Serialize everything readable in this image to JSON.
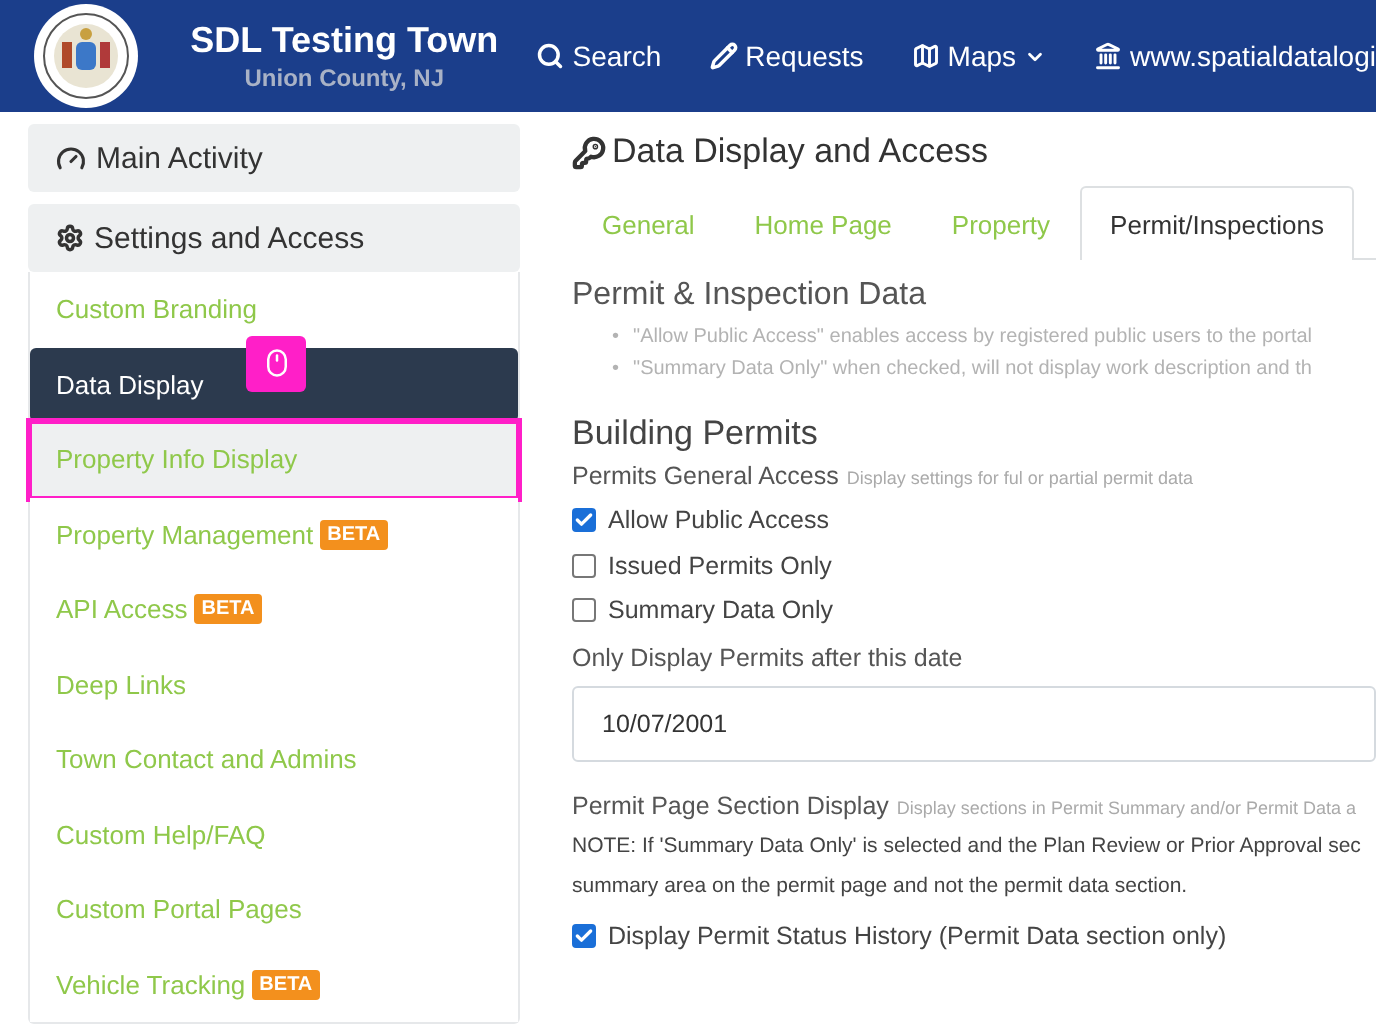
{
  "header": {
    "title": "SDL Testing Town",
    "subtitle": "Union County, NJ",
    "nav": [
      {
        "kind": "search",
        "label": "Search"
      },
      {
        "kind": "pencil",
        "label": "Requests"
      },
      {
        "kind": "map",
        "label": "Maps",
        "dropdown": true
      },
      {
        "kind": "bank",
        "label": "www.spatialdatalogi"
      }
    ]
  },
  "sidebar": {
    "main_panel": "Main Activity",
    "settings_panel": "Settings and Access",
    "items": [
      {
        "label": "Custom Branding",
        "selected": false,
        "highlighted": false
      },
      {
        "label": "Data Display",
        "selected": true,
        "highlighted": false,
        "pointer": true
      },
      {
        "label": "Property Info Display",
        "selected": false,
        "highlighted": true
      },
      {
        "label": "Property Management",
        "selected": false,
        "highlighted": false,
        "badge": "BETA"
      },
      {
        "label": "API Access",
        "selected": false,
        "highlighted": false,
        "badge": "BETA"
      },
      {
        "label": "Deep Links",
        "selected": false,
        "highlighted": false
      },
      {
        "label": "Town Contact and Admins",
        "selected": false,
        "highlighted": false
      },
      {
        "label": "Custom Help/FAQ",
        "selected": false,
        "highlighted": false
      },
      {
        "label": "Custom Portal Pages",
        "selected": false,
        "highlighted": false
      },
      {
        "label": "Vehicle Tracking",
        "selected": false,
        "highlighted": false,
        "badge": "BETA"
      }
    ]
  },
  "main": {
    "title": "Data Display and Access",
    "tabs": [
      {
        "label": "General",
        "selected": false
      },
      {
        "label": "Home Page",
        "selected": false
      },
      {
        "label": "Property",
        "selected": false
      },
      {
        "label": "Permit/Inspections",
        "selected": true
      }
    ],
    "section_title": "Permit & Inspection Data",
    "bullets": [
      {
        "marker": "•",
        "text": "\"Allow Public Access\" enables access by registered public users to the portal"
      },
      {
        "marker": "•",
        "text": "\"Summary Data Only\" when checked, will not display work description and th"
      }
    ],
    "building_title": "Building Permits",
    "access_label": "Permits General Access",
    "access_hint": "Display settings for ful or partial permit data",
    "options": [
      {
        "label": "Allow Public Access",
        "checked": true
      },
      {
        "label": "Issued Permits Only",
        "checked": false
      },
      {
        "label": "Summary Data Only",
        "checked": false
      }
    ],
    "date_label": "Only Display Permits after this date",
    "date_value": "10/07/2001",
    "section_display_label": "Permit Page Section Display",
    "section_display_hint": "Display sections in Permit Summary and/or Permit Data a",
    "note_lines": [
      "NOTE: If 'Summary Data Only' is selected and the Plan Review or Prior Approval sec",
      "summary area on the permit page and not the permit data section."
    ],
    "display_options": [
      {
        "label": "Display Permit Status History (Permit Data section only)",
        "checked": true
      }
    ]
  }
}
